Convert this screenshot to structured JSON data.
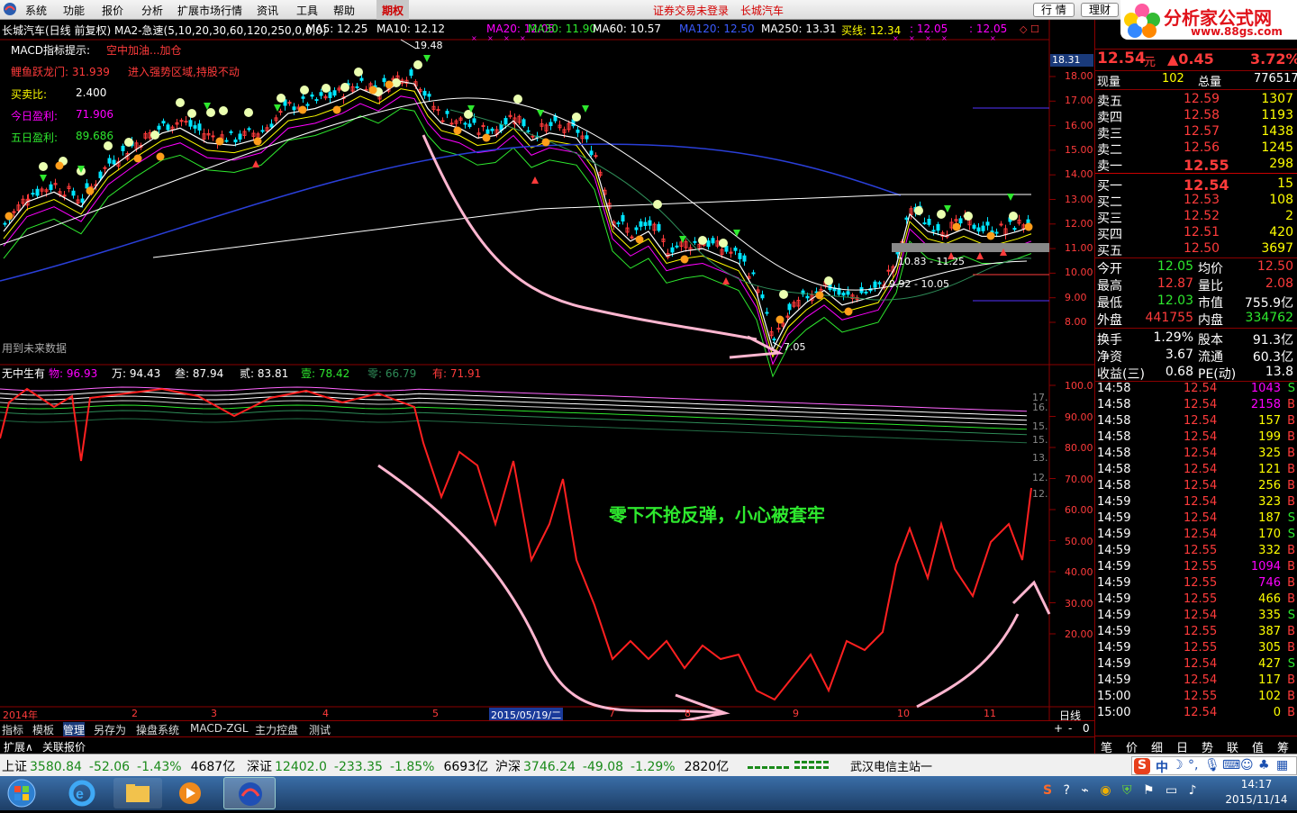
{
  "menu": {
    "items": [
      "系统",
      "功能",
      "报价",
      "分析",
      "扩展市场行情",
      "资讯",
      "工具",
      "帮助"
    ],
    "options_tab": "期权",
    "login_status": "证券交易未登录",
    "stock_title": "长城汽车",
    "quote_button": "行 情",
    "finance_button": "理财",
    "brand": "分析家公式网",
    "brand_url": "www.88gs.com"
  },
  "main_chart": {
    "header": "长城汽车(日线 前复权) MA2-急速(5,10,20,30,60,120,250,0,0,0)",
    "ma_labels": [
      {
        "text": "MA5: 12.25",
        "color": "#ffffff"
      },
      {
        "text": "MA10: 12.12",
        "color": "#ffffff"
      },
      {
        "text": "MA20: 12.05",
        "color": "#ff00ff"
      },
      {
        "text": "MA30: 11.90",
        "color": "#2ee82e"
      },
      {
        "text": "MA60: 10.57",
        "color": "#ffffff"
      },
      {
        "text": "MA120: 12.50",
        "color": "#3b5bff"
      },
      {
        "text": "MA250: 13.31",
        "color": "#ffffff"
      },
      {
        "text": "买线: 12.34",
        "color": "#ffff00"
      },
      {
        "text": ": 12.05",
        "color": "#ff00ff"
      },
      {
        "text": ": 12.05",
        "color": "#ff00ff"
      }
    ],
    "signals": [
      {
        "label": "MACD指标提示:",
        "value": "空中加油...加仓"
      },
      {
        "label": "鲤鱼跃龙门: 31.939",
        "value": "进入强势区域,持股不动"
      },
      {
        "label": "买卖比:",
        "value": "2.400"
      },
      {
        "label": "今日盈利:",
        "value": "71.906"
      },
      {
        "label": "五日盈利:",
        "value": "89.686"
      }
    ],
    "future_note": "用到未来数据",
    "high_mark": "19.48",
    "low_mark": "7.05",
    "range_marks": [
      "10.83 - 11.25",
      "9.92 - 10.05"
    ],
    "price_axis": [
      "18.00",
      "17.00",
      "16.00",
      "15.00",
      "14.00",
      "13.00",
      "12.00",
      "11.00",
      "10.00",
      "9.00",
      "8.00"
    ],
    "current_price_tag": "18.31"
  },
  "sub_chart": {
    "header_name": "无中生有",
    "labels": [
      {
        "text": "物: 96.93",
        "color": "#ff00ff"
      },
      {
        "text": "万: 94.43",
        "color": "#ffffff"
      },
      {
        "text": "叁: 87.94",
        "color": "#ffffff"
      },
      {
        "text": "贰: 83.81",
        "color": "#ffffff"
      },
      {
        "text": "壹: 78.42",
        "color": "#2ee82e"
      },
      {
        "text": "零: 66.79",
        "color": "#2e8b57"
      },
      {
        "text": "有: 71.91",
        "color": "#ff3b3b"
      }
    ],
    "annotation": "零下不抢反弹，小心被套牢",
    "axis": [
      "100.0",
      "90.00",
      "80.00",
      "70.00",
      "60.00",
      "50.00",
      "40.00",
      "30.00",
      "20.00"
    ],
    "right_marks": [
      "17.",
      "16.",
      "15.",
      "15.",
      "13.",
      "12.",
      "12."
    ]
  },
  "time_axis": {
    "year_label": "2014年",
    "months": [
      "2",
      "3",
      "4",
      "5",
      "6",
      "7",
      "8",
      "9",
      "10",
      "11"
    ],
    "cursor_date": "2015/05/19/二",
    "period": "日线"
  },
  "bottom_tabs": [
    "指标",
    "模板",
    "管理",
    "另存为",
    "操盘系统",
    "MACD-ZGL",
    "主力控盘",
    "测试"
  ],
  "bottom_tabs2": [
    "扩展∧",
    "关联报价"
  ],
  "quote_panel": {
    "price": "12.54",
    "unit": "元",
    "change": "▲0.45",
    "change_pct": "3.72%",
    "now_vol_label": "现量",
    "now_vol": "102",
    "total_vol_label": "总量",
    "total_vol": "776517",
    "asks": [
      {
        "label": "卖五",
        "price": "12.59",
        "vol": "1307"
      },
      {
        "label": "卖四",
        "price": "12.58",
        "vol": "1193"
      },
      {
        "label": "卖三",
        "price": "12.57",
        "vol": "1438"
      },
      {
        "label": "卖二",
        "price": "12.56",
        "vol": "1245"
      },
      {
        "label": "卖一",
        "price": "12.55",
        "vol": "298"
      }
    ],
    "bids": [
      {
        "label": "买一",
        "price": "12.54",
        "vol": "15"
      },
      {
        "label": "买二",
        "price": "12.53",
        "vol": "108"
      },
      {
        "label": "买三",
        "price": "12.52",
        "vol": "2"
      },
      {
        "label": "买四",
        "price": "12.51",
        "vol": "420"
      },
      {
        "label": "买五",
        "price": "12.50",
        "vol": "3697"
      }
    ],
    "stats": [
      {
        "l1": "今开",
        "v1": "12.05",
        "c1": "#2ee82e",
        "l2": "均价",
        "v2": "12.50",
        "c2": "#ff3b3b"
      },
      {
        "l1": "最高",
        "v1": "12.87",
        "c1": "#ff3b3b",
        "l2": "量比",
        "v2": "2.08",
        "c2": "#ff3b3b"
      },
      {
        "l1": "最低",
        "v1": "12.03",
        "c1": "#2ee82e",
        "l2": "市值",
        "v2": "755.9亿",
        "c2": "#ffffff"
      },
      {
        "l1": "外盘",
        "v1": "441755",
        "c1": "#ff3b3b",
        "l2": "内盘",
        "v2": "334762",
        "c2": "#2ee82e"
      },
      {
        "l1": "换手",
        "v1": "1.29%",
        "c1": "#ffffff",
        "l2": "股本",
        "v2": "91.3亿",
        "c2": "#ffffff"
      },
      {
        "l1": "净资",
        "v1": "3.67",
        "c1": "#ffffff",
        "l2": "流通",
        "v2": "60.3亿",
        "c2": "#ffffff"
      },
      {
        "l1": "收益(三)",
        "v1": "0.68",
        "c1": "#ffffff",
        "l2": "PE(动)",
        "v2": "13.8",
        "c2": "#ffffff"
      }
    ],
    "ticks": [
      {
        "t": "14:58",
        "p": "12.54",
        "v": "1043",
        "s": "S"
      },
      {
        "t": "14:58",
        "p": "12.54",
        "v": "2158",
        "s": "B"
      },
      {
        "t": "14:58",
        "p": "12.54",
        "v": "157",
        "s": "B"
      },
      {
        "t": "14:58",
        "p": "12.54",
        "v": "199",
        "s": "B"
      },
      {
        "t": "14:58",
        "p": "12.54",
        "v": "325",
        "s": "B"
      },
      {
        "t": "14:58",
        "p": "12.54",
        "v": "121",
        "s": "B"
      },
      {
        "t": "14:58",
        "p": "12.54",
        "v": "256",
        "s": "B"
      },
      {
        "t": "14:59",
        "p": "12.54",
        "v": "323",
        "s": "B"
      },
      {
        "t": "14:59",
        "p": "12.54",
        "v": "187",
        "s": "S"
      },
      {
        "t": "14:59",
        "p": "12.54",
        "v": "170",
        "s": "S"
      },
      {
        "t": "14:59",
        "p": "12.55",
        "v": "332",
        "s": "B"
      },
      {
        "t": "14:59",
        "p": "12.55",
        "v": "1094",
        "s": "B"
      },
      {
        "t": "14:59",
        "p": "12.55",
        "v": "746",
        "s": "B"
      },
      {
        "t": "14:59",
        "p": "12.55",
        "v": "466",
        "s": "B"
      },
      {
        "t": "14:59",
        "p": "12.54",
        "v": "335",
        "s": "S"
      },
      {
        "t": "14:59",
        "p": "12.55",
        "v": "387",
        "s": "B"
      },
      {
        "t": "14:59",
        "p": "12.55",
        "v": "305",
        "s": "B"
      },
      {
        "t": "14:59",
        "p": "12.54",
        "v": "427",
        "s": "S"
      },
      {
        "t": "14:59",
        "p": "12.54",
        "v": "117",
        "s": "B"
      },
      {
        "t": "15:00",
        "p": "12.55",
        "v": "102",
        "s": "B"
      },
      {
        "t": "15:00",
        "p": "12.54",
        "v": "0",
        "s": "B"
      }
    ],
    "tabs": [
      "笔",
      "价",
      "细",
      "日",
      "势",
      "联",
      "值",
      "筹"
    ]
  },
  "status_bar": {
    "indices": [
      {
        "name": "上证",
        "value": "3580.84",
        "chg": "-52.06",
        "pct": "-1.43%",
        "amt": "4687亿"
      },
      {
        "name": "深证",
        "value": "12402.0",
        "chg": "-233.35",
        "pct": "-1.85%",
        "amt": "6693亿"
      },
      {
        "name": "沪深",
        "value": "3746.24",
        "chg": "-49.08",
        "pct": "-1.29%",
        "amt": "2820亿"
      }
    ],
    "server": "武汉电信主站一"
  },
  "taskbar": {
    "time": "14:17",
    "date": "2015/11/14",
    "ime": "中"
  }
}
